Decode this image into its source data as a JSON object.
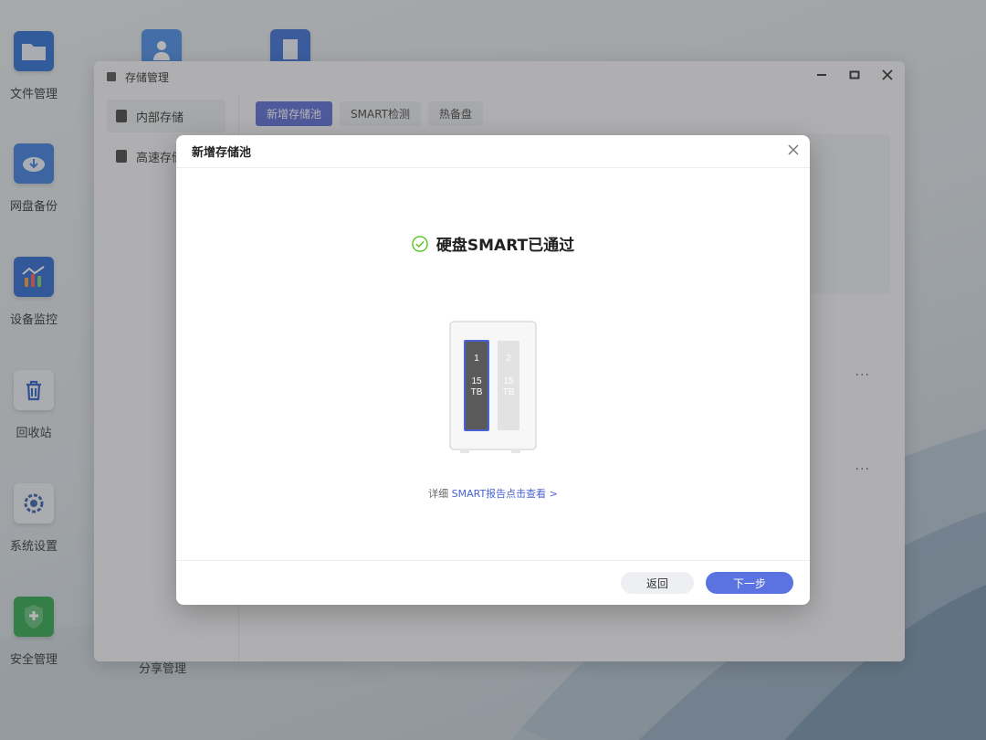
{
  "desktop": {
    "icons": [
      {
        "label": "文件管理",
        "icon": "folder-icon"
      },
      {
        "label": "网盘备份",
        "icon": "cloud-download-icon"
      },
      {
        "label": "设备监控",
        "icon": "chart-icon"
      },
      {
        "label": "回收站",
        "icon": "trash-icon"
      },
      {
        "label": "系统设置",
        "icon": "gear-icon"
      },
      {
        "label": "安全管理",
        "icon": "shield-icon"
      }
    ],
    "partial_label": "分享管理"
  },
  "window": {
    "title": "存储管理",
    "sidebar": [
      {
        "label": "内部存储",
        "active": true
      },
      {
        "label": "高速存储",
        "active": false
      }
    ],
    "tabs": [
      {
        "label": "新增存储池",
        "active": true
      },
      {
        "label": "SMART检测",
        "active": false
      },
      {
        "label": "热备盘",
        "active": false
      }
    ],
    "row_menu": "···"
  },
  "modal": {
    "title": "新增存储池",
    "status_text": "硬盘SMART已通过",
    "disks": [
      {
        "slot": "1",
        "capacity": "15",
        "unit": "TB",
        "selected": true
      },
      {
        "slot": "2",
        "capacity": "15",
        "unit": "TB",
        "selected": false
      }
    ],
    "detail_prefix": "详细",
    "detail_link": "SMART报告点击查看 >",
    "back_label": "返回",
    "next_label": "下一步"
  },
  "colors": {
    "accent": "#5b73e0",
    "success": "#52c41a",
    "link": "#4a63d4"
  }
}
